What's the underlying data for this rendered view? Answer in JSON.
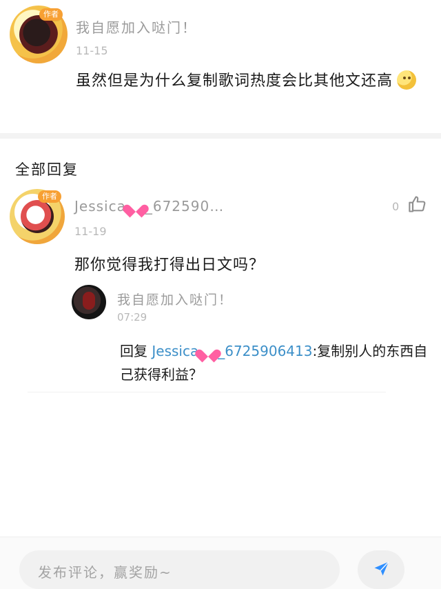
{
  "topComment": {
    "authorBadge": "作者",
    "name": "我自愿加入哒门！",
    "date": "11-15",
    "text": "虽然但是为什么复制歌词热度会比其他文还高",
    "emoji": "thinking-face"
  },
  "section": {
    "title": "全部回复"
  },
  "reply1": {
    "authorBadge": "作者",
    "namePrefix": "Jessica",
    "nameSuffix": "_672590…",
    "likeCount": "0",
    "date": "11-19",
    "text": "那你觉得我打得出日文吗？"
  },
  "reply2": {
    "name": "我自愿加入哒门！",
    "date": "07:29",
    "replyLead": "回复 ",
    "mentionPrefix": "Jessica",
    "mentionSuffix": "_6725906413",
    "replyText": ":复制别人的东西自己获得利益？"
  },
  "composer": {
    "placeholder": "发布评论，赢奖励~"
  },
  "icons": {
    "like": "thumbs-up-icon",
    "send": "paper-plane-icon",
    "heart": "heart-emoji-icon"
  },
  "colors": {
    "badge": "#f7a033",
    "mention": "#3c8fc8",
    "send": "#2f8fff"
  }
}
